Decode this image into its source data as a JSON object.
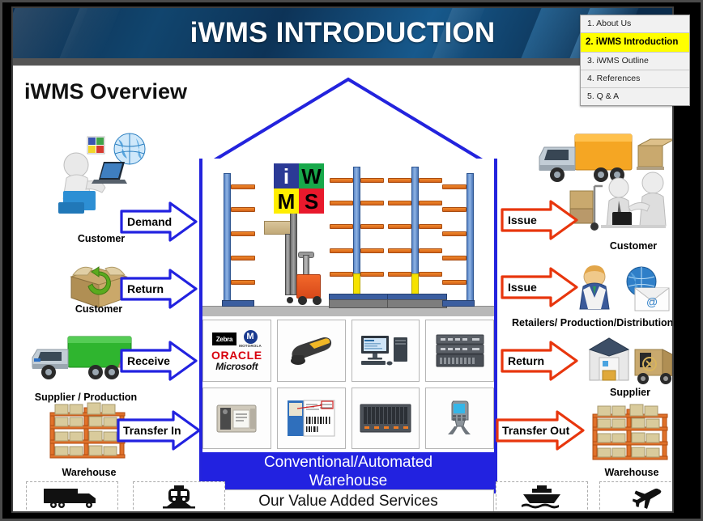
{
  "slide": {
    "title": "iWMS INTRODUCTION",
    "heading": "iWMS Overview"
  },
  "nav": {
    "items": [
      {
        "label": "1. About Us",
        "active": false
      },
      {
        "label": "2. iWMS Introduction",
        "active": true
      },
      {
        "label": "3. iWMS Outline",
        "active": false
      },
      {
        "label": "4. References",
        "active": false
      },
      {
        "label": "5. Q & A",
        "active": false
      }
    ]
  },
  "logo": {
    "cells": [
      {
        "letter": "i",
        "bg": "#2b3a96",
        "fg": "#ffffff"
      },
      {
        "letter": "W",
        "bg": "#17a84a",
        "fg": "#000000"
      },
      {
        "letter": "M",
        "bg": "#ffee00",
        "fg": "#000000"
      },
      {
        "letter": "S",
        "bg": "#e8192c",
        "fg": "#000000"
      }
    ]
  },
  "inbound": [
    {
      "arrow": "Demand",
      "actor": "Customer",
      "icon": "person-at-laptop-icon"
    },
    {
      "arrow": "Return",
      "actor": "Customer",
      "icon": "return-box-icon"
    },
    {
      "arrow": "Receive",
      "actor": "Supplier / Production",
      "icon": "green-delivery-truck-icon"
    },
    {
      "arrow": "Transfer In",
      "actor": "Warehouse",
      "icon": "pallet-racking-icon"
    }
  ],
  "outbound": [
    {
      "arrow": "Issue",
      "actor": "Customer",
      "icon": "handshake-delivery-icon"
    },
    {
      "arrow": "Issue",
      "actor": "Retailers/ Production/Distribution Centers",
      "icon": "agent-email-icon"
    },
    {
      "arrow": "Return",
      "actor": "Supplier",
      "icon": "warehouse-van-icon"
    },
    {
      "arrow": "Transfer Out",
      "actor": "Warehouse",
      "icon": "pallet-racking-icon"
    }
  ],
  "tech_cells": [
    {
      "name": "brand-logos",
      "labels": [
        "Zebra",
        "MOTOROLA",
        "ORACLE",
        "Microsoft"
      ]
    },
    {
      "name": "barcode-scanner-icon",
      "labels": []
    },
    {
      "name": "desktop-workstation-icon",
      "labels": []
    },
    {
      "name": "rack-server-icon",
      "labels": []
    },
    {
      "name": "label-printer-icon",
      "labels": []
    },
    {
      "name": "shipping-label-icon",
      "labels": []
    },
    {
      "name": "storage-array-icon",
      "labels": []
    },
    {
      "name": "mobile-handheld-terminal-icon",
      "labels": []
    }
  ],
  "banner": {
    "line1": "Conventional/Automated",
    "line2": "Warehouse",
    "value": "Our Value Added Services"
  },
  "transport": [
    {
      "name": "truck-icon",
      "side": "left"
    },
    {
      "name": "train-icon",
      "side": "left"
    },
    {
      "name": "ship-icon",
      "side": "right"
    },
    {
      "name": "airplane-icon",
      "side": "right"
    }
  ],
  "colors": {
    "inbound_arrow": "#2222e0",
    "outbound_arrow": "#e8360d",
    "banner_blue": "#2222e0",
    "highlight_yellow": "#ffff00",
    "title_blue": "#0d3357"
  }
}
